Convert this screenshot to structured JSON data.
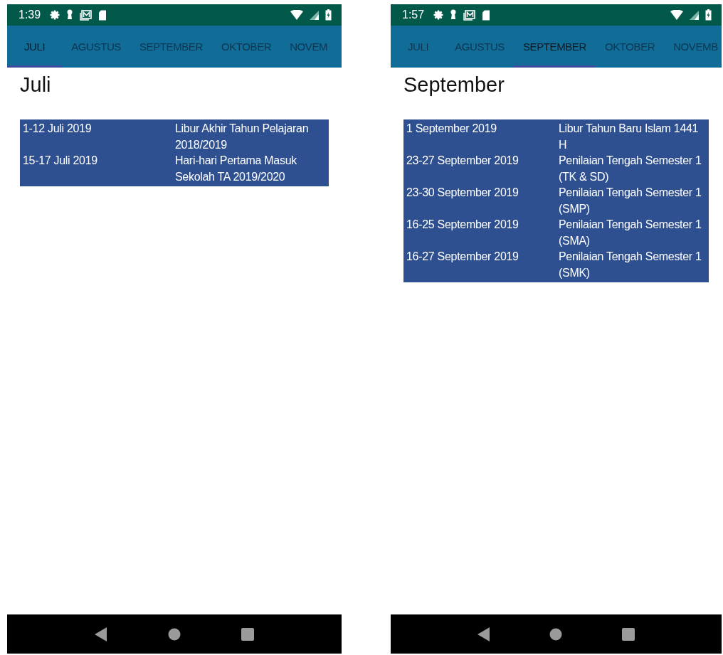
{
  "screens": [
    {
      "status_bar": {
        "time": "1:39"
      },
      "tabs": [
        {
          "label": "JULI",
          "selected": true
        },
        {
          "label": "AGUSTUS",
          "selected": false
        },
        {
          "label": "SEPTEMBER",
          "selected": false
        },
        {
          "label": "OKTOBER",
          "selected": false
        },
        {
          "label": "NOVEM",
          "selected": false
        }
      ],
      "heading": "Juli",
      "rows": [
        {
          "date": "1-12 Juli 2019",
          "event": "Libur Akhir Tahun Pelajaran 2018/2019"
        },
        {
          "date": "15-17 Juli 2019",
          "event": "Hari-hari Pertama Masuk Sekolah TA 2019/2020"
        }
      ]
    },
    {
      "status_bar": {
        "time": "1:57"
      },
      "tabs": [
        {
          "label": "JULI",
          "selected": false
        },
        {
          "label": "AGUSTUS",
          "selected": false
        },
        {
          "label": "SEPTEMBER",
          "selected": true
        },
        {
          "label": "OKTOBER",
          "selected": false
        },
        {
          "label": "NOVEMB",
          "selected": false
        }
      ],
      "heading": "September",
      "rows": [
        {
          "date": "1 September 2019",
          "event": "Libur Tahun Baru Islam 1441 H"
        },
        {
          "date": "23-27 September 2019",
          "event": "Penilaian Tengah Semester 1 (TK & SD)"
        },
        {
          "date": "23-30 September 2019",
          "event": "Penilaian Tengah Semester 1 (SMP)"
        },
        {
          "date": "16-25 September 2019",
          "event": "Penilaian Tengah Semester 1 (SMA)"
        },
        {
          "date": "16-27 September 2019",
          "event": "Penilaian Tengah Semester 1 (SMK)"
        }
      ]
    }
  ]
}
